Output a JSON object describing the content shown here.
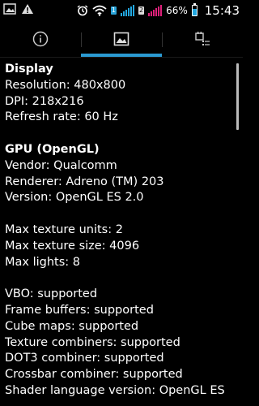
{
  "status_bar": {
    "battery_percent_text": "66%",
    "battery_level": 0.66,
    "time": "15:43",
    "sim1_label": "1",
    "sim2_label": "2",
    "icons": [
      "photo-icon",
      "warning-icon",
      "alarm-icon",
      "wifi-icon",
      "signal-icon",
      "battery-icon"
    ]
  },
  "tabs": [
    {
      "icon": "info-icon",
      "selected": false
    },
    {
      "icon": "image-icon",
      "selected": true
    },
    {
      "icon": "sensors-list-icon",
      "selected": false
    }
  ],
  "display_section": {
    "title": "Display",
    "resolution": "Resolution: 480x800",
    "dpi": "DPI: 218x216",
    "refresh_rate": "Refresh rate: 60 Hz"
  },
  "gpu_section": {
    "title": "GPU (OpenGL)",
    "vendor": "Vendor: Qualcomm",
    "renderer": "Renderer: Adreno (TM) 203",
    "version": "Version: OpenGL ES 2.0",
    "max_texture_units": "Max texture units: 2",
    "max_texture_size": "Max texture size: 4096",
    "max_lights": "Max lights: 8",
    "vbo": "VBO: supported",
    "frame_buffers": "Frame buffers: supported",
    "cube_maps": "Cube maps: supported",
    "texture_combiners": "Texture combiners: supported",
    "dot3_combiner": "DOT3 combiner: supported",
    "crossbar_combiner": "Crossbar combiner: supported",
    "shader_language": "Shader language version: OpenGL ES"
  },
  "colors": {
    "accent": "#2b9ad2",
    "background": "#000000",
    "text": "#ffffff"
  }
}
